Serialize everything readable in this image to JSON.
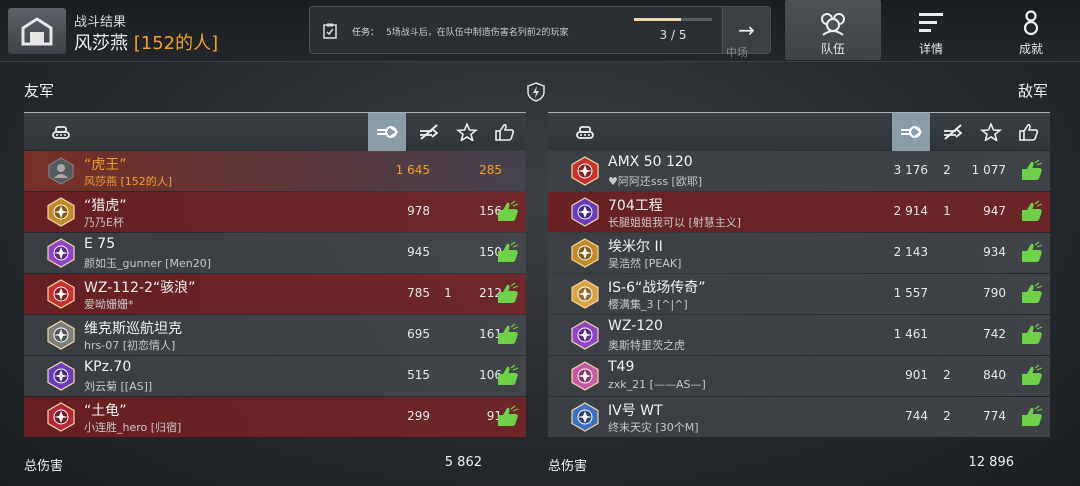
{
  "header": {
    "small_title": "战斗结果",
    "player_name": "风莎燕",
    "player_clan": "[152的人]",
    "mission_label": "任务：",
    "mission_desc": "5场战斗后，在队伍中制造伤害名列前2的玩家",
    "mission_progress": "3 / 5",
    "mission_progress_fraction": 0.6,
    "arrow": "→",
    "hidden_tab_text": "中场"
  },
  "tabs": [
    {
      "label": "队伍",
      "icon": "team-icon",
      "active": true
    },
    {
      "label": "详情",
      "icon": "details-icon",
      "active": false
    },
    {
      "label": "成就",
      "icon": "medal-icon",
      "active": false
    }
  ],
  "allies_label": "友军",
  "enemies_label": "敌军",
  "allies": [
    {
      "tank": "“虎王”",
      "player": "风莎燕 [152的人]",
      "damage": "1 645",
      "kills": "",
      "points": "285",
      "mine": true,
      "red": false,
      "liked": false
    },
    {
      "tank": "“猎虎”",
      "player": "乃乃E杯",
      "damage": "978",
      "kills": "",
      "points": "156",
      "mine": false,
      "red": true,
      "liked": true
    },
    {
      "tank": "E 75",
      "player": "颜如玉_gunner [Men20]",
      "damage": "945",
      "kills": "",
      "points": "150",
      "mine": false,
      "red": false,
      "liked": true
    },
    {
      "tank": "WZ-112-2“骇浪”",
      "player": "爱呦姗姗*",
      "damage": "785",
      "kills": "1",
      "points": "212",
      "mine": false,
      "red": true,
      "liked": true
    },
    {
      "tank": "维克斯巡航坦克",
      "player": "hrs-07 [初恋情人]",
      "damage": "695",
      "kills": "",
      "points": "161",
      "mine": false,
      "red": false,
      "liked": true
    },
    {
      "tank": "KPz.70",
      "player": "刘云菊 [[AS]]",
      "damage": "515",
      "kills": "",
      "points": "106",
      "mine": false,
      "red": false,
      "liked": true
    },
    {
      "tank": "“土龟”",
      "player": "小连胜_hero [归宿]",
      "damage": "299",
      "kills": "",
      "points": "91",
      "mine": false,
      "red": true,
      "liked": true
    }
  ],
  "enemies": [
    {
      "tank": "AMX 50 120",
      "player": "♥阿阿还sss [欧耶]",
      "damage": "3 176",
      "kills": "2",
      "points": "1 077",
      "red": false,
      "liked": true
    },
    {
      "tank": "704工程",
      "player": "长腿姐姐我可以 [射慧主义]",
      "damage": "2 914",
      "kills": "1",
      "points": "947",
      "red": true,
      "liked": true
    },
    {
      "tank": "埃米尔 II",
      "player": "吴浩然 [PEAK]",
      "damage": "2 143",
      "kills": "",
      "points": "934",
      "red": false,
      "liked": true
    },
    {
      "tank": "IS-6“战场传奇”",
      "player": "樱满集_3 [^|^]",
      "damage": "1 557",
      "kills": "",
      "points": "790",
      "red": false,
      "liked": true
    },
    {
      "tank": "WZ-120",
      "player": "奥斯特里茨之虎",
      "damage": "1 461",
      "kills": "",
      "points": "742",
      "red": false,
      "liked": true
    },
    {
      "tank": "T49",
      "player": "zxk_21 [——AS—]",
      "damage": "901",
      "kills": "2",
      "points": "840",
      "red": false,
      "liked": true
    },
    {
      "tank": "IV号 WT",
      "player": "终末天灾 [30个M]",
      "damage": "744",
      "kills": "2",
      "points": "774",
      "red": false,
      "liked": true
    }
  ],
  "totals": {
    "allies_label": "总伤害",
    "allies_value": "5 862",
    "enemies_label": "总伤害",
    "enemies_value": "12 896"
  },
  "colors": {
    "accent": "#f0a030",
    "like_green": "#6fd04a",
    "selected_column": "#8a9ca8"
  }
}
